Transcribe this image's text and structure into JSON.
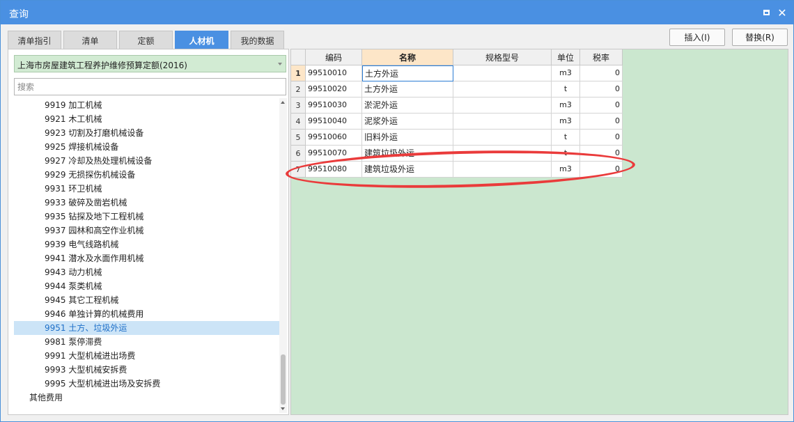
{
  "window": {
    "title": "查询",
    "maximize_glyph": "□",
    "close_glyph": "✕"
  },
  "tabs": [
    {
      "label": "清单指引",
      "active": false
    },
    {
      "label": "清单",
      "active": false
    },
    {
      "label": "定额",
      "active": false
    },
    {
      "label": "人材机",
      "active": true
    },
    {
      "label": "我的数据",
      "active": false
    }
  ],
  "toolbar": {
    "insert_label": "插入(I)",
    "replace_label": "替换(R)"
  },
  "left": {
    "library_selected": "上海市房屋建筑工程养护维修预算定额(2016)",
    "search_placeholder": "搜索",
    "tree_items": [
      {
        "label": "9919 加工机械",
        "level": "child"
      },
      {
        "label": "9921 木工机械",
        "level": "child"
      },
      {
        "label": "9923 切割及打磨机械设备",
        "level": "child"
      },
      {
        "label": "9925 焊接机械设备",
        "level": "child"
      },
      {
        "label": "9927 冷却及热处理机械设备",
        "level": "child"
      },
      {
        "label": "9929 无损探伤机械设备",
        "level": "child"
      },
      {
        "label": "9931 环卫机械",
        "level": "child"
      },
      {
        "label": "9933 破碎及凿岩机械",
        "level": "child"
      },
      {
        "label": "9935 钻探及地下工程机械",
        "level": "child"
      },
      {
        "label": "9937 园林和高空作业机械",
        "level": "child"
      },
      {
        "label": "9939 电气线路机械",
        "level": "child"
      },
      {
        "label": "9941 潜水及水面作用机械",
        "level": "child"
      },
      {
        "label": "9943 动力机械",
        "level": "child"
      },
      {
        "label": "9944 泵类机械",
        "level": "child"
      },
      {
        "label": "9945 其它工程机械",
        "level": "child"
      },
      {
        "label": "9946 单独计算的机械费用",
        "level": "child"
      },
      {
        "label": "9951 土方、垃圾外运",
        "level": "child",
        "selected": true
      },
      {
        "label": "9981 泵停滞费",
        "level": "child"
      },
      {
        "label": "9991 大型机械进出场费",
        "level": "child"
      },
      {
        "label": "9993 大型机械安拆费",
        "level": "child"
      },
      {
        "label": "9995 大型机械进出场及安拆费",
        "level": "child"
      },
      {
        "label": "其他费用",
        "level": "root"
      }
    ]
  },
  "grid": {
    "columns": [
      "编码",
      "名称",
      "规格型号",
      "单位",
      "税率"
    ],
    "sorted_column": 1,
    "rows": [
      {
        "num": "1",
        "code": "99510010",
        "name": "土方外运",
        "spec": "",
        "unit": "m3",
        "rate": "0"
      },
      {
        "num": "2",
        "code": "99510020",
        "name": "土方外运",
        "spec": "",
        "unit": "t",
        "rate": "0"
      },
      {
        "num": "3",
        "code": "99510030",
        "name": "淤泥外运",
        "spec": "",
        "unit": "m3",
        "rate": "0"
      },
      {
        "num": "4",
        "code": "99510040",
        "name": "泥浆外运",
        "spec": "",
        "unit": "m3",
        "rate": "0"
      },
      {
        "num": "5",
        "code": "99510060",
        "name": "旧料外运",
        "spec": "",
        "unit": "t",
        "rate": "0"
      },
      {
        "num": "6",
        "code": "99510070",
        "name": "建筑垃圾外运",
        "spec": "",
        "unit": "t",
        "rate": "0"
      },
      {
        "num": "7",
        "code": "99510080",
        "name": "建筑垃圾外运",
        "spec": "",
        "unit": "m3",
        "rate": "0"
      }
    ]
  },
  "colors": {
    "titlebar": "#4a90e2",
    "active_tab": "#4a90e2",
    "grid_background": "#cbe7cf",
    "selected_tree": "#cce4f7",
    "annotation": "#ea3b3b"
  }
}
